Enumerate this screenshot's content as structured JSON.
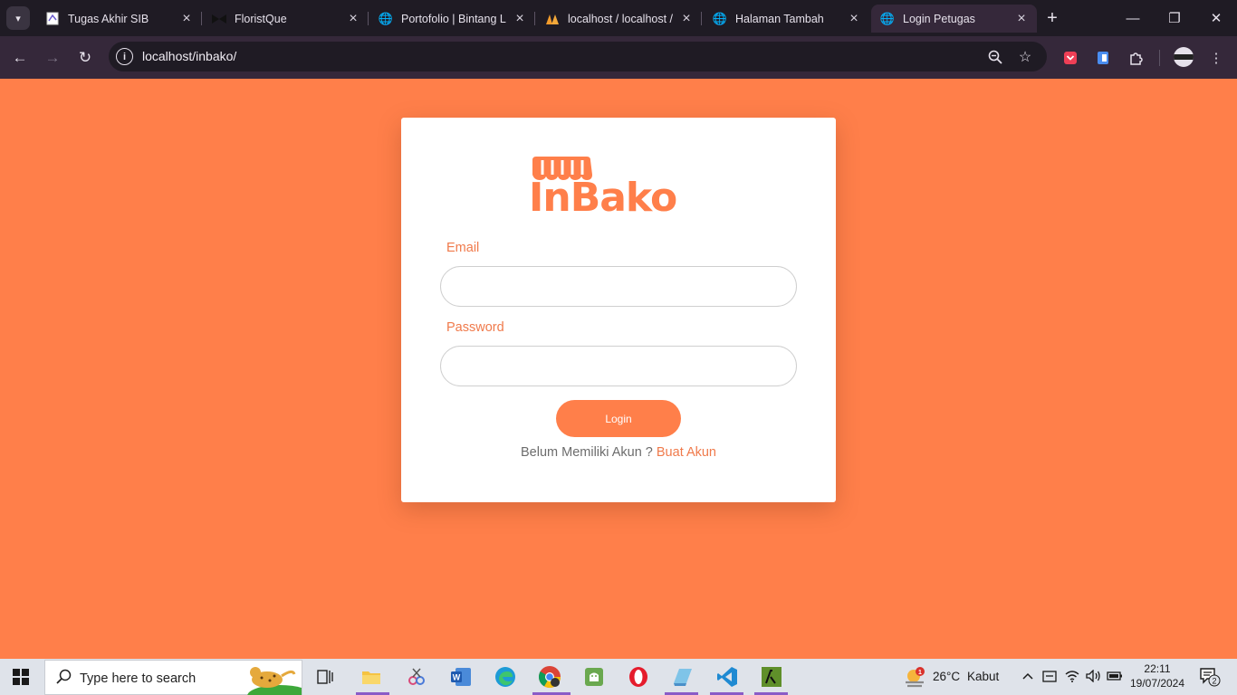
{
  "browser": {
    "tabs": [
      {
        "title": "Tugas Akhir SIB",
        "icon": "document-icon",
        "active": false
      },
      {
        "title": "FloristQue",
        "icon": "bowtie-icon",
        "active": false
      },
      {
        "title": "Portofolio | Bintang L",
        "icon": "globe-icon",
        "active": false
      },
      {
        "title": "localhost / localhost /",
        "icon": "phpmyadmin-icon",
        "active": false
      },
      {
        "title": "Halaman Tambah",
        "icon": "globe-icon",
        "active": false
      },
      {
        "title": "Login Petugas",
        "icon": "globe-icon",
        "active": true
      }
    ],
    "url": "localhost/inbako/",
    "toolbar_icons": [
      "zoom-icon",
      "star-icon",
      "pocket-icon",
      "clipboard-icon",
      "puzzle-icon",
      "profile-icon",
      "menu-icon"
    ]
  },
  "page": {
    "logo_text": "InBako",
    "email_label": "Email",
    "email_value": "",
    "password_label": "Password",
    "password_value": "",
    "login_button": "Login",
    "signup_prompt": "Belum Memiliki Akun ?",
    "signup_link": "Buat Akun",
    "accent_color": "#ff7f4a"
  },
  "taskbar": {
    "search_placeholder": "Type here to search",
    "weather_temp": "26°C",
    "weather_desc": "Kabut",
    "weather_badge": "1",
    "time": "22:11",
    "date": "19/07/2024",
    "notification_count": "2",
    "apps": [
      "task-view-icon",
      "file-explorer-icon",
      "snipping-icon",
      "word-icon",
      "edge-icon",
      "chrome-icon",
      "android-icon",
      "opera-icon",
      "notepad-icon",
      "vscode-icon",
      "terminal-icon"
    ]
  }
}
